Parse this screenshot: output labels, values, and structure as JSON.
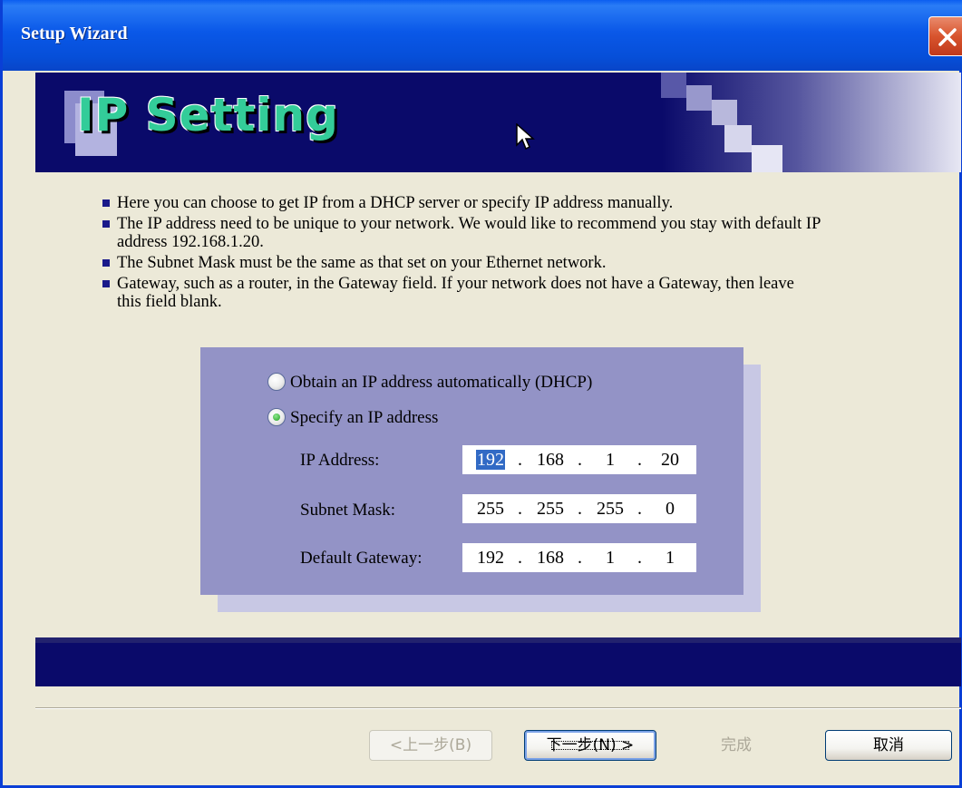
{
  "window": {
    "title": "Setup Wizard"
  },
  "banner": {
    "title": "IP Setting"
  },
  "bullets": [
    "Here you can choose to get IP from a DHCP server or specify IP address manually.",
    "The IP address need to be unique to your network. We would like to recommend you stay with default IP address 192.168.1.20.",
    "The Subnet Mask must be the same as that set on your Ethernet network.",
    "Gateway, such as a router, in the Gateway field. If your network does not have a Gateway, then leave this field blank."
  ],
  "options": {
    "dhcp_label": "Obtain an IP address automatically (DHCP)",
    "specify_label": "Specify an IP address",
    "selected": "specify"
  },
  "fields": {
    "ip_label": "IP Address:",
    "ip": [
      "192",
      "168",
      "1",
      "20"
    ],
    "subnet_label": "Subnet Mask:",
    "subnet": [
      "255",
      "255",
      "255",
      "0"
    ],
    "gateway_label": "Default Gateway:",
    "gateway": [
      "192",
      "168",
      "1",
      "1"
    ]
  },
  "buttons": {
    "back": "<上一步(B)",
    "next": "下一步(N) >",
    "finish": "完成",
    "cancel": "取消"
  },
  "colors": {
    "titlebar": "#0a58e8",
    "banner": "#0a0a6a",
    "panel": "#9393c6",
    "banner_title": "#33cc99",
    "selection": "#316ac5"
  },
  "icons": {
    "close": "close-icon",
    "cursor": "mouse-pointer-icon"
  }
}
